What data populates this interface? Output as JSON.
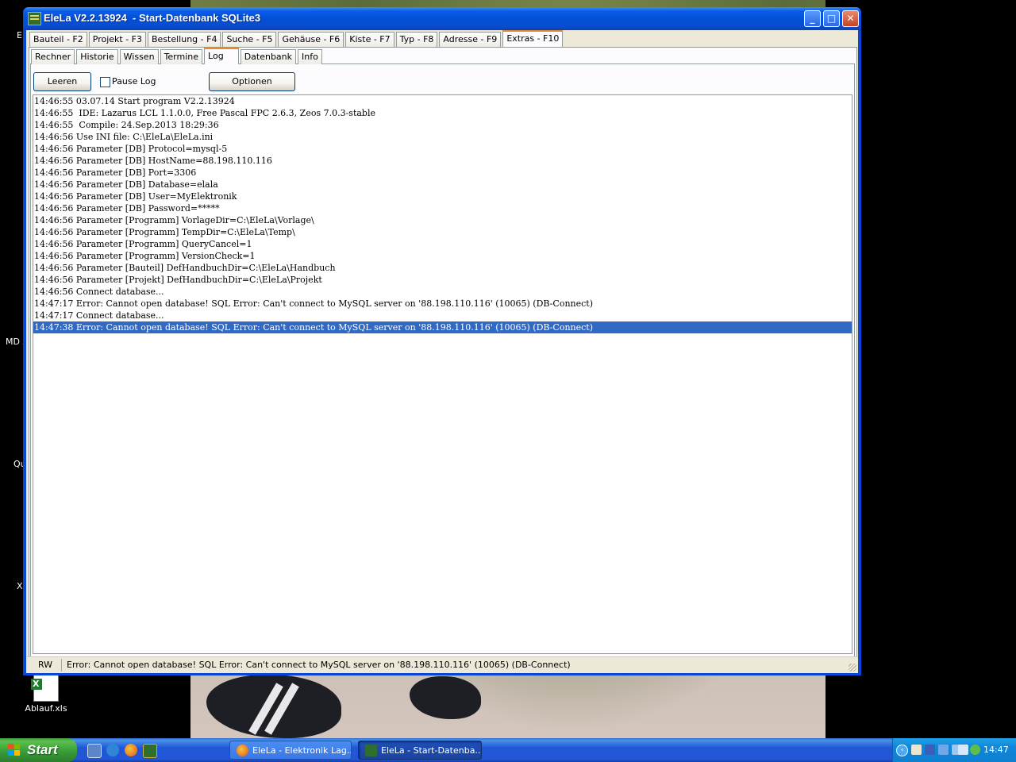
{
  "desktop": {
    "fragments": [
      "E",
      "MD A",
      "Qu",
      "X"
    ],
    "icon_label": "Ablauf.xls"
  },
  "window": {
    "title": "EleLa V2.2.13924  - Start-Datenbank SQLite3",
    "minimize_glyph": "_",
    "maximize_glyph": "□",
    "close_glyph": "✕"
  },
  "main_tabs": [
    {
      "label": "Bauteil - F2"
    },
    {
      "label": "Projekt - F3"
    },
    {
      "label": "Bestellung - F4"
    },
    {
      "label": "Suche - F5"
    },
    {
      "label": "Gehäuse - F6"
    },
    {
      "label": "Kiste - F7"
    },
    {
      "label": "Typ - F8"
    },
    {
      "label": "Adresse - F9"
    },
    {
      "label": "Extras - F10",
      "active": true
    }
  ],
  "sub_tabs": [
    {
      "label": "Rechner"
    },
    {
      "label": "Historie"
    },
    {
      "label": "Wissen"
    },
    {
      "label": "Termine"
    },
    {
      "label": "Log",
      "active": true
    },
    {
      "label": "Datenbank"
    },
    {
      "label": "Info"
    }
  ],
  "log_panel": {
    "clear_label": "Leeren",
    "pause_label": "Pause Log",
    "pause_checked": false,
    "options_label": "Optionen"
  },
  "log_lines": [
    "14:46:55 03.07.14 Start program V2.2.13924",
    "14:46:55  IDE: Lazarus LCL 1.1.0.0, Free Pascal FPC 2.6.3, Zeos 7.0.3-stable",
    "14:46:55  Compile: 24.Sep.2013 18:29:36",
    "14:46:56 Use INI file: C:\\EleLa\\EleLa.ini",
    "14:46:56 Parameter [DB] Protocol=mysql-5",
    "14:46:56 Parameter [DB] HostName=88.198.110.116",
    "14:46:56 Parameter [DB] Port=3306",
    "14:46:56 Parameter [DB] Database=elala",
    "14:46:56 Parameter [DB] User=MyElektronik",
    "14:46:56 Parameter [DB] Password=*****",
    "14:46:56 Parameter [Programm] VorlageDir=C:\\EleLa\\Vorlage\\",
    "14:46:56 Parameter [Programm] TempDir=C:\\EleLa\\Temp\\",
    "14:46:56 Parameter [Programm] QueryCancel=1",
    "14:46:56 Parameter [Programm] VersionCheck=1",
    "14:46:56 Parameter [Bauteil] DefHandbuchDir=C:\\EleLa\\Handbuch",
    "14:46:56 Parameter [Projekt] DefHandbuchDir=C:\\EleLa\\Projekt",
    "14:46:56 Connect database...",
    "14:47:17 Error: Cannot open database! SQL Error: Can't connect to MySQL server on '88.198.110.116' (10065) (DB-Connect)",
    "14:47:17 Connect database...",
    "14:47:38 Error: Cannot open database! SQL Error: Can't connect to MySQL server on '88.198.110.116' (10065) (DB-Connect)"
  ],
  "selected_line_index": 19,
  "statusbar": {
    "mode": "RW",
    "message": "Error: Cannot open database! SQL Error: Can't connect to MySQL server on '88.198.110.116' (10065) (DB-Connect)"
  },
  "taskbar": {
    "start_label": "Start",
    "quick_launch": [
      "outlook-icon",
      "ie-icon",
      "firefox-icon",
      "elela-icon"
    ],
    "tasks": [
      {
        "label": "EleLa - Elektronik Lag...",
        "icon": "firefox-icon"
      },
      {
        "label": "EleLa - Start-Datenba...",
        "icon": "elela-icon",
        "active": true
      }
    ],
    "clock": "14:47"
  },
  "colors": {
    "titlebar": "#0a50d6",
    "selection": "#316ac5",
    "active_tab_accent": "#e68b2c",
    "taskbar": "#2157d7",
    "start_button": "#379937"
  }
}
